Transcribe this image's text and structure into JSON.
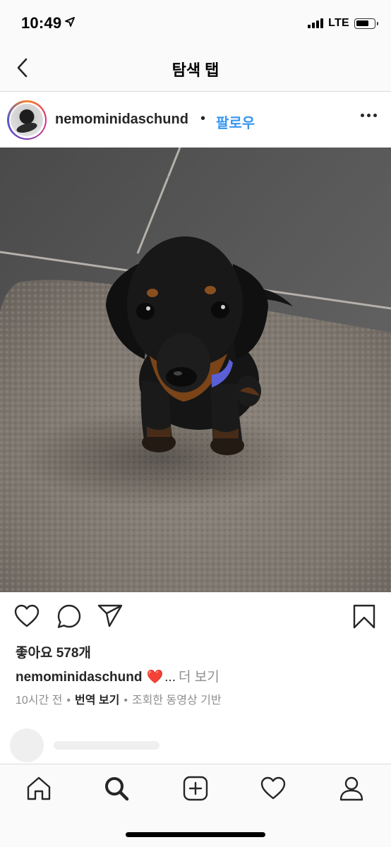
{
  "status_bar": {
    "time": "10:49",
    "network": "LTE"
  },
  "nav": {
    "title": "탐색 탭",
    "back_icon": "chevron-left-icon"
  },
  "post": {
    "username": "nemominidaschund",
    "separator": "•",
    "follow_label": "팔로우",
    "more_icon": "more-horizontal-icon",
    "image_alt": "Black and tan dachshund puppy sitting on a gray bath mat on a tiled floor",
    "actions": {
      "like_icon": "heart-icon",
      "comment_icon": "comment-icon",
      "share_icon": "send-icon",
      "save_icon": "bookmark-icon"
    },
    "likes_text": "좋아요 578개",
    "caption": {
      "username": "nemominidaschund",
      "emoji": "❤️",
      "ellipsis": "...",
      "more_label": "더 보기"
    },
    "meta": {
      "time": "10시간 전",
      "translate_label": "번역 보기",
      "based_on": "조회한 동영상 기반",
      "dot": "•"
    }
  },
  "tab_bar": {
    "items": [
      "home-icon",
      "search-icon",
      "add-post-icon",
      "activity-heart-icon",
      "profile-icon"
    ]
  },
  "colors": {
    "link_blue": "#3897f0",
    "text": "#262626",
    "muted": "#8e8e8e",
    "heart_red": "#e0245e"
  }
}
